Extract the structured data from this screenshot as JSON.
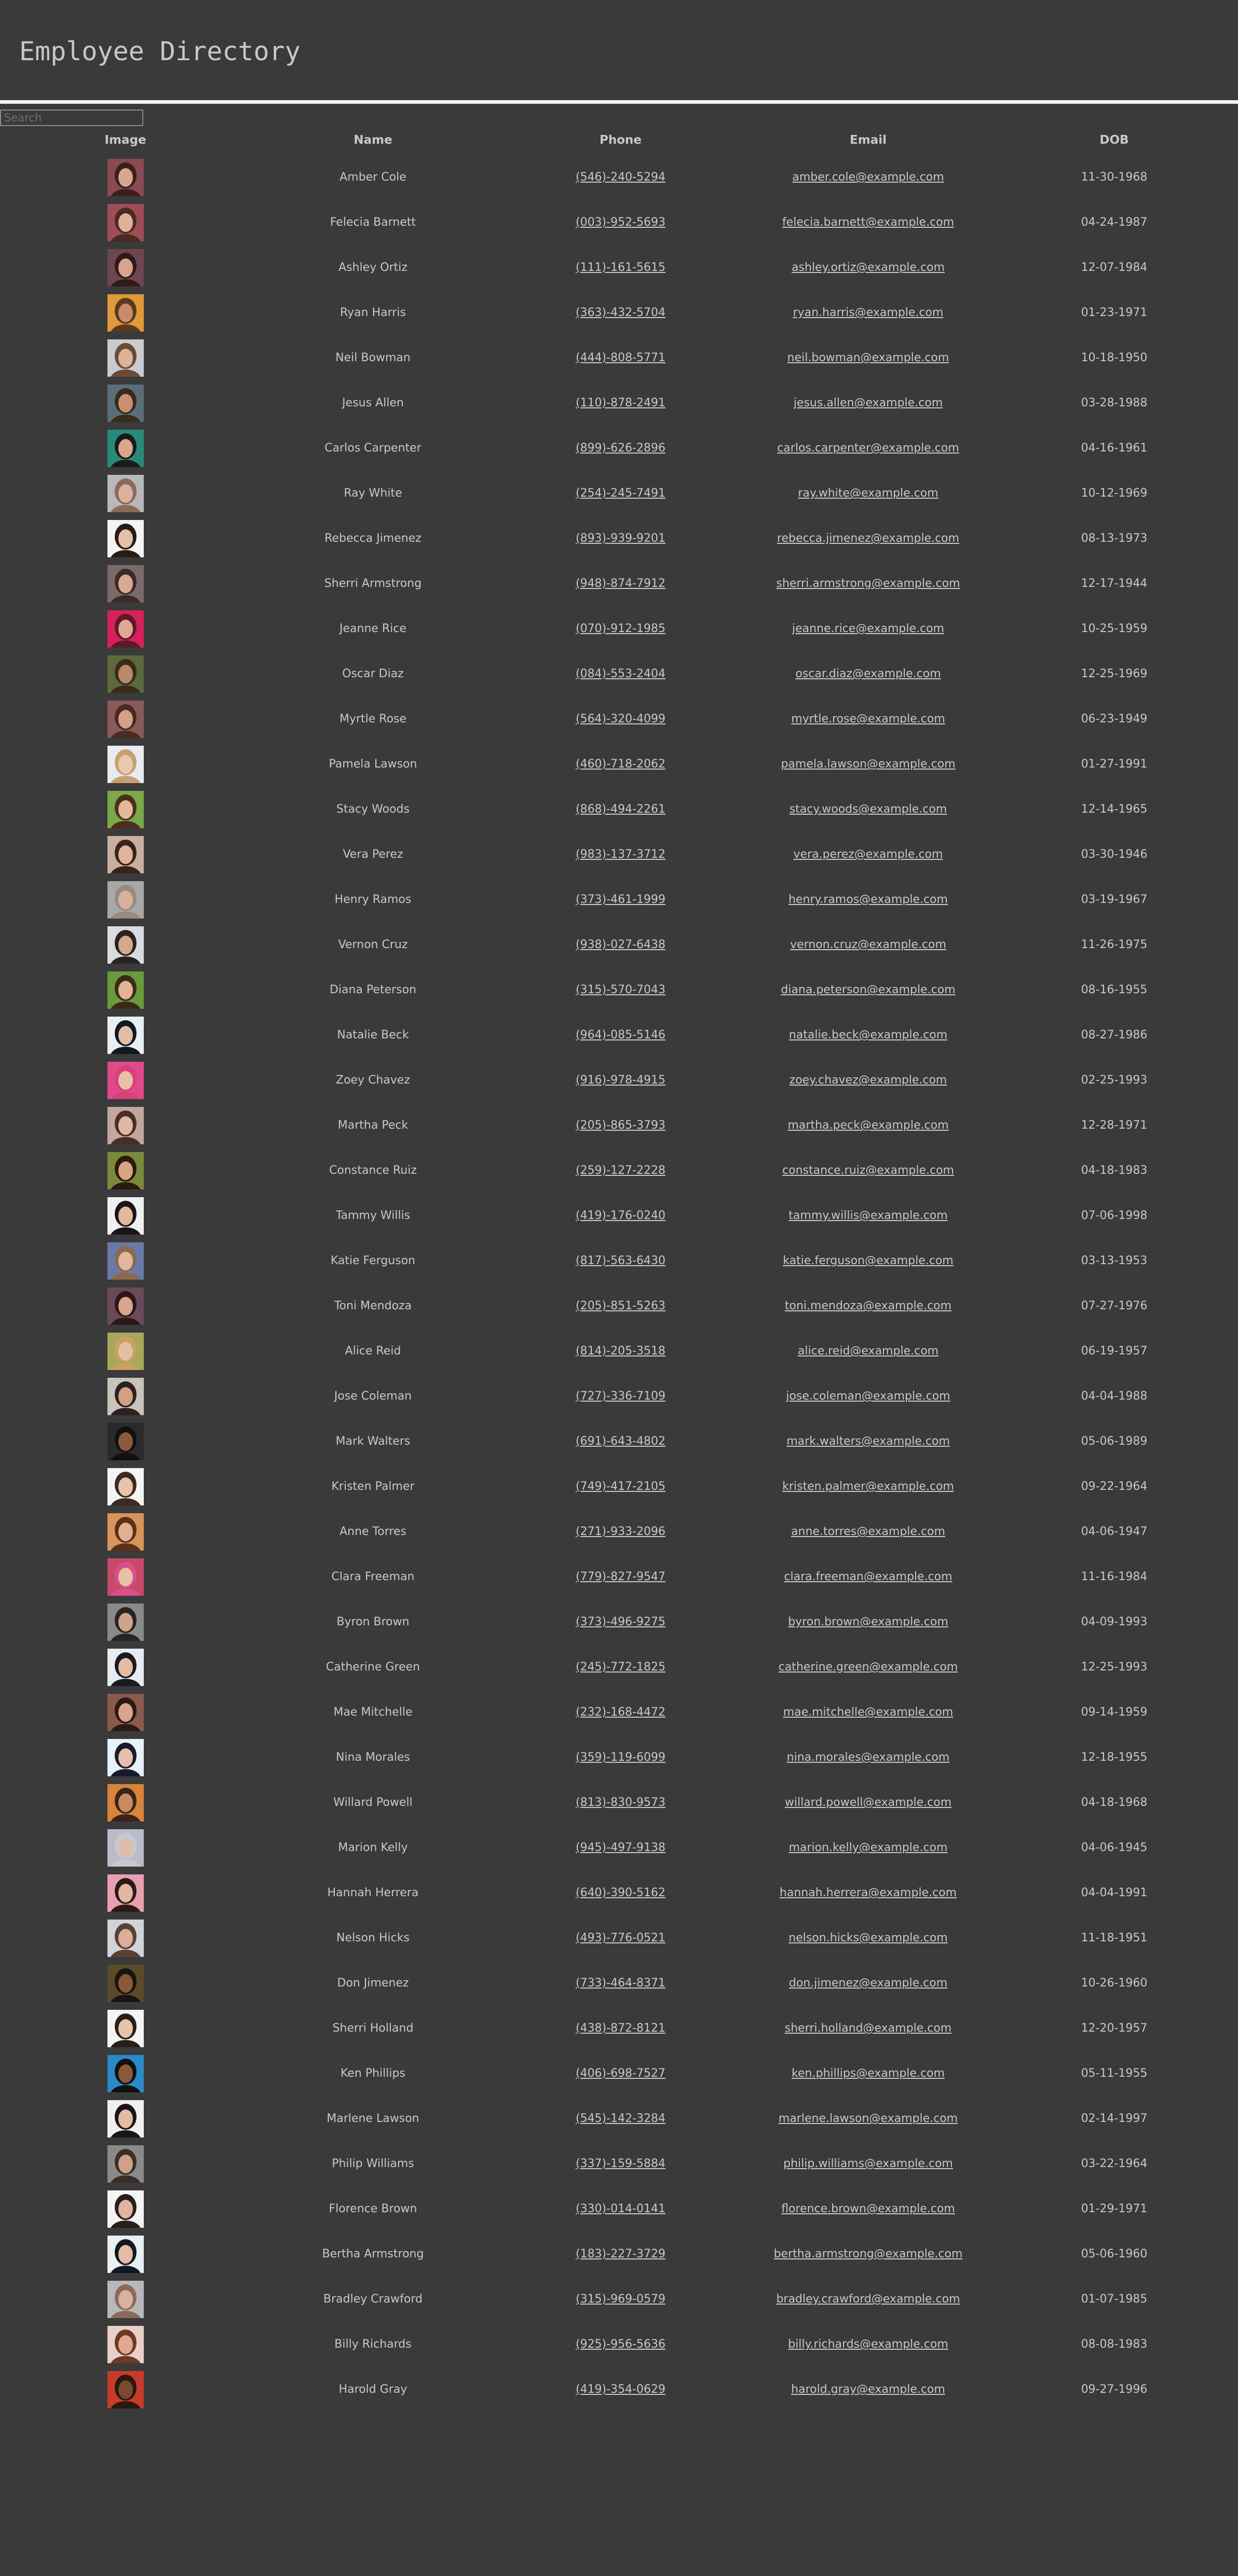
{
  "page": {
    "title": "Employee Directory"
  },
  "search": {
    "placeholder": "Search",
    "value": ""
  },
  "table": {
    "headers": [
      "Image",
      "Name",
      "Phone",
      "Email",
      "DOB"
    ],
    "rows": [
      {
        "name": "Amber Cole",
        "phone": "(546)-240-5294",
        "email": "amber.cole@example.com",
        "dob": "11-30-1968",
        "avatar_bg": "#8a4a52",
        "avatar_skin": "#d9a58e",
        "avatar_hair": "#3a1f1c"
      },
      {
        "name": "Felecia Barnett",
        "phone": "(003)-952-5693",
        "email": "felecia.barnett@example.com",
        "dob": "04-24-1987",
        "avatar_bg": "#a04c58",
        "avatar_skin": "#e0b09a",
        "avatar_hair": "#4a2a22"
      },
      {
        "name": "Ashley Ortiz",
        "phone": "(111)-161-5615",
        "email": "ashley.ortiz@example.com",
        "dob": "12-07-1984",
        "avatar_bg": "#6e4650",
        "avatar_skin": "#d8a48c",
        "avatar_hair": "#2e1b18"
      },
      {
        "name": "Ryan Harris",
        "phone": "(363)-432-5704",
        "email": "ryan.harris@example.com",
        "dob": "01-23-1971",
        "avatar_bg": "#e09a3a",
        "avatar_skin": "#c98a6a",
        "avatar_hair": "#5a3a1e"
      },
      {
        "name": "Neil Bowman",
        "phone": "(444)-808-5771",
        "email": "neil.bowman@example.com",
        "dob": "10-18-1950",
        "avatar_bg": "#c8ccd0",
        "avatar_skin": "#dcb49a",
        "avatar_hair": "#6b4a34"
      },
      {
        "name": "Jesus Allen",
        "phone": "(110)-878-2491",
        "email": "jesus.allen@example.com",
        "dob": "03-28-1988",
        "avatar_bg": "#5a6e7a",
        "avatar_skin": "#c89070",
        "avatar_hair": "#3a2a1e"
      },
      {
        "name": "Carlos Carpenter",
        "phone": "(899)-626-2896",
        "email": "carlos.carpenter@example.com",
        "dob": "04-16-1961",
        "avatar_bg": "#2a8a7a",
        "avatar_skin": "#d8a888",
        "avatar_hair": "#1a1a1a"
      },
      {
        "name": "Ray White",
        "phone": "(254)-245-7491",
        "email": "ray.white@example.com",
        "dob": "10-12-1969",
        "avatar_bg": "#b8b8bc",
        "avatar_skin": "#dcb0a0",
        "avatar_hair": "#8a6a58"
      },
      {
        "name": "Rebecca Jimenez",
        "phone": "(893)-939-9201",
        "email": "rebecca.jimenez@example.com",
        "dob": "08-13-1973",
        "avatar_bg": "#f4f4f4",
        "avatar_skin": "#e4c0a8",
        "avatar_hair": "#2a1a14"
      },
      {
        "name": "Sherri Armstrong",
        "phone": "(948)-874-7912",
        "email": "sherri.armstrong@example.com",
        "dob": "12-17-1944",
        "avatar_bg": "#7a6a6e",
        "avatar_skin": "#d8aa94",
        "avatar_hair": "#3e2a24"
      },
      {
        "name": "Jeanne Rice",
        "phone": "(070)-912-1985",
        "email": "jeanne.rice@example.com",
        "dob": "10-25-1959",
        "avatar_bg": "#d8205a",
        "avatar_skin": "#e0a890",
        "avatar_hair": "#5a1a2a"
      },
      {
        "name": "Oscar Diaz",
        "phone": "(084)-553-2404",
        "email": "oscar.diaz@example.com",
        "dob": "12-25-1969",
        "avatar_bg": "#5a6a3a",
        "avatar_skin": "#b88a6a",
        "avatar_hair": "#3a2a1a"
      },
      {
        "name": "Myrtle Rose",
        "phone": "(564)-320-4099",
        "email": "myrtle.rose@example.com",
        "dob": "06-23-1949",
        "avatar_bg": "#8a5a5a",
        "avatar_skin": "#d4a08a",
        "avatar_hair": "#4a2a22"
      },
      {
        "name": "Pamela Lawson",
        "phone": "(460)-718-2062",
        "email": "pamela.lawson@example.com",
        "dob": "01-27-1991",
        "avatar_bg": "#e8ecf0",
        "avatar_skin": "#e8c8b0",
        "avatar_hair": "#c8a070"
      },
      {
        "name": "Stacy Woods",
        "phone": "(868)-494-2261",
        "email": "stacy.woods@example.com",
        "dob": "12-14-1965",
        "avatar_bg": "#7aa84a",
        "avatar_skin": "#e4b898",
        "avatar_hair": "#4a2e1e"
      },
      {
        "name": "Vera Perez",
        "phone": "(983)-137-3712",
        "email": "vera.perez@example.com",
        "dob": "03-30-1946",
        "avatar_bg": "#c8b0a0",
        "avatar_skin": "#e0b498",
        "avatar_hair": "#3a2418"
      },
      {
        "name": "Henry Ramos",
        "phone": "(373)-461-1999",
        "email": "henry.ramos@example.com",
        "dob": "03-19-1967",
        "avatar_bg": "#a8a8a8",
        "avatar_skin": "#d8b09c",
        "avatar_hair": "#9a8a80"
      },
      {
        "name": "Vernon Cruz",
        "phone": "(938)-027-6438",
        "email": "vernon.cruz@example.com",
        "dob": "11-26-1975",
        "avatar_bg": "#d8dce0",
        "avatar_skin": "#d8a88c",
        "avatar_hair": "#2a2220"
      },
      {
        "name": "Diana Peterson",
        "phone": "(315)-570-7043",
        "email": "diana.peterson@example.com",
        "dob": "08-16-1955",
        "avatar_bg": "#6a9a3a",
        "avatar_skin": "#e0b494",
        "avatar_hair": "#3a2a1a"
      },
      {
        "name": "Natalie Beck",
        "phone": "(964)-085-5146",
        "email": "natalie.beck@example.com",
        "dob": "08-27-1986",
        "avatar_bg": "#e8f0f4",
        "avatar_skin": "#e4bca4",
        "avatar_hair": "#101820"
      },
      {
        "name": "Zoey Chavez",
        "phone": "(916)-978-4915",
        "email": "zoey.chavez@example.com",
        "dob": "02-25-1993",
        "avatar_bg": "#e04a8a",
        "avatar_skin": "#e8c0a8",
        "avatar_hair": "#d8407a"
      },
      {
        "name": "Martha Peck",
        "phone": "(205)-865-3793",
        "email": "martha.peck@example.com",
        "dob": "12-28-1971",
        "avatar_bg": "#c0a8a0",
        "avatar_skin": "#e0b8a0",
        "avatar_hair": "#4a2e24"
      },
      {
        "name": "Constance Ruiz",
        "phone": "(259)-127-2228",
        "email": "constance.ruiz@example.com",
        "dob": "04-18-1983",
        "avatar_bg": "#7a8a3a",
        "avatar_skin": "#d8a484",
        "avatar_hair": "#2a1a10"
      },
      {
        "name": "Tammy Willis",
        "phone": "(419)-176-0240",
        "email": "tammy.willis@example.com",
        "dob": "07-06-1998",
        "avatar_bg": "#f0f0f0",
        "avatar_skin": "#e4b89c",
        "avatar_hair": "#1a1418"
      },
      {
        "name": "Katie Ferguson",
        "phone": "(817)-563-6430",
        "email": "katie.ferguson@example.com",
        "dob": "03-13-1953",
        "avatar_bg": "#6a7aa8",
        "avatar_skin": "#e0b8a0",
        "avatar_hair": "#8a6a4a"
      },
      {
        "name": "Toni Mendoza",
        "phone": "(205)-851-5263",
        "email": "toni.mendoza@example.com",
        "dob": "07-27-1976",
        "avatar_bg": "#6a4a5a",
        "avatar_skin": "#d8a48c",
        "avatar_hair": "#2a1818"
      },
      {
        "name": "Alice Reid",
        "phone": "(814)-205-3518",
        "email": "alice.reid@example.com",
        "dob": "06-19-1957",
        "avatar_bg": "#a8a85a",
        "avatar_skin": "#e4c0a0",
        "avatar_hair": "#c8a060"
      },
      {
        "name": "Jose Coleman",
        "phone": "(727)-336-7109",
        "email": "jose.coleman@example.com",
        "dob": "04-04-1988",
        "avatar_bg": "#c8c4bc",
        "avatar_skin": "#d4a084",
        "avatar_hair": "#2a2220"
      },
      {
        "name": "Mark Walters",
        "phone": "(691)-643-4802",
        "email": "mark.walters@example.com",
        "dob": "05-06-1989",
        "avatar_bg": "#2a2a2a",
        "avatar_skin": "#8a5a3a",
        "avatar_hair": "#101010"
      },
      {
        "name": "Kristen Palmer",
        "phone": "(749)-417-2105",
        "email": "kristen.palmer@example.com",
        "dob": "09-22-1964",
        "avatar_bg": "#f4f4f4",
        "avatar_skin": "#e8c4ac",
        "avatar_hair": "#3a2a20"
      },
      {
        "name": "Anne Torres",
        "phone": "(271)-933-2096",
        "email": "anne.torres@example.com",
        "dob": "04-06-1947",
        "avatar_bg": "#d8945a",
        "avatar_skin": "#e0b090",
        "avatar_hair": "#5a3018"
      },
      {
        "name": "Clara Freeman",
        "phone": "(779)-827-9547",
        "email": "clara.freeman@example.com",
        "dob": "11-16-1984",
        "avatar_bg": "#c84a6a",
        "avatar_skin": "#e8c0a8",
        "avatar_hair": "#d8508a"
      },
      {
        "name": "Byron Brown",
        "phone": "(373)-496-9275",
        "email": "byron.brown@example.com",
        "dob": "04-09-1993",
        "avatar_bg": "#8a8a8a",
        "avatar_skin": "#d0a48c",
        "avatar_hair": "#2a2420"
      },
      {
        "name": "Catherine Green",
        "phone": "(245)-772-1825",
        "email": "catherine.green@example.com",
        "dob": "12-25-1993",
        "avatar_bg": "#e8ecf0",
        "avatar_skin": "#e4bca4",
        "avatar_hair": "#1a1a20"
      },
      {
        "name": "Mae Mitchelle",
        "phone": "(232)-168-4472",
        "email": "mae.mitchelle@example.com",
        "dob": "09-14-1959",
        "avatar_bg": "#8a5a4a",
        "avatar_skin": "#d8a48a",
        "avatar_hair": "#2a1a14"
      },
      {
        "name": "Nina Morales",
        "phone": "(359)-119-6099",
        "email": "nina.morales@example.com",
        "dob": "12-18-1955",
        "avatar_bg": "#e8f0f8",
        "avatar_skin": "#e4c0a8",
        "avatar_hair": "#1a1a2a"
      },
      {
        "name": "Willard Powell",
        "phone": "(813)-830-9573",
        "email": "willard.powell@example.com",
        "dob": "04-18-1968",
        "avatar_bg": "#d8843a",
        "avatar_skin": "#c88a64",
        "avatar_hair": "#3a2418"
      },
      {
        "name": "Marion Kelly",
        "phone": "(945)-497-9138",
        "email": "marion.kelly@example.com",
        "dob": "04-06-1945",
        "avatar_bg": "#b8bcc8",
        "avatar_skin": "#e0bca8",
        "avatar_hair": "#c8c8d0"
      },
      {
        "name": "Hannah Herrera",
        "phone": "(640)-390-5162",
        "email": "hannah.herrera@example.com",
        "dob": "04-04-1991",
        "avatar_bg": "#e8a0b0",
        "avatar_skin": "#e4b8a0",
        "avatar_hair": "#2a1a18"
      },
      {
        "name": "Nelson Hicks",
        "phone": "(493)-776-0521",
        "email": "nelson.hicks@example.com",
        "dob": "11-18-1951",
        "avatar_bg": "#d0d4d8",
        "avatar_skin": "#dcb098",
        "avatar_hair": "#5a4034"
      },
      {
        "name": "Don Jimenez",
        "phone": "(733)-464-8371",
        "email": "don.jimenez@example.com",
        "dob": "10-26-1960",
        "avatar_bg": "#5a4a2a",
        "avatar_skin": "#8a5a38",
        "avatar_hair": "#1a1410"
      },
      {
        "name": "Sherri Holland",
        "phone": "(438)-872-8121",
        "email": "sherri.holland@example.com",
        "dob": "12-20-1957",
        "avatar_bg": "#f4f4f4",
        "avatar_skin": "#e8c4ac",
        "avatar_hair": "#2a1e18"
      },
      {
        "name": "Ken Phillips",
        "phone": "(406)-698-7527",
        "email": "ken.phillips@example.com",
        "dob": "05-11-1955",
        "avatar_bg": "#2a8ac8",
        "avatar_skin": "#8a5a3c",
        "avatar_hair": "#101010"
      },
      {
        "name": "Marlene Lawson",
        "phone": "(545)-142-3284",
        "email": "marlene.lawson@example.com",
        "dob": "02-14-1997",
        "avatar_bg": "#f0f0f0",
        "avatar_skin": "#e4bca4",
        "avatar_hair": "#1a1418"
      },
      {
        "name": "Philip Williams",
        "phone": "(337)-159-5884",
        "email": "philip.williams@example.com",
        "dob": "03-22-1964",
        "avatar_bg": "#8a8a8a",
        "avatar_skin": "#d0a088",
        "avatar_hair": "#3a2e28"
      },
      {
        "name": "Florence Brown",
        "phone": "(330)-014-0141",
        "email": "florence.brown@example.com",
        "dob": "01-29-1971",
        "avatar_bg": "#f4f4f4",
        "avatar_skin": "#e0b4a0",
        "avatar_hair": "#2a1e1a"
      },
      {
        "name": "Bertha Armstrong",
        "phone": "(183)-227-3729",
        "email": "bertha.armstrong@example.com",
        "dob": "05-06-1960",
        "avatar_bg": "#e8f0f4",
        "avatar_skin": "#e4bca4",
        "avatar_hair": "#101820"
      },
      {
        "name": "Bradley Crawford",
        "phone": "(315)-969-0579",
        "email": "bradley.crawford@example.com",
        "dob": "01-07-1985",
        "avatar_bg": "#b8b8bc",
        "avatar_skin": "#dcb0a0",
        "avatar_hair": "#8a6a58"
      },
      {
        "name": "Billy Richards",
        "phone": "(925)-956-5636",
        "email": "billy.richards@example.com",
        "dob": "08-08-1983",
        "avatar_bg": "#e8d0c8",
        "avatar_skin": "#e0a890",
        "avatar_hair": "#6a3a28"
      },
      {
        "name": "Harold Gray",
        "phone": "(419)-354-0629",
        "email": "harold.gray@example.com",
        "dob": "09-27-1996",
        "avatar_bg": "#c83a2a",
        "avatar_skin": "#7a4a30",
        "avatar_hair": "#2a1810"
      }
    ]
  }
}
